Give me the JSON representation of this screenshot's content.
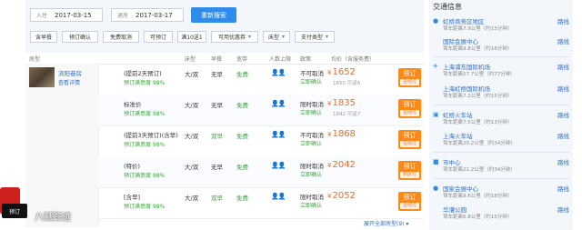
{
  "search": {
    "checkin_label": "入住",
    "checkin_value": "2017-03-15",
    "checkout_label": "退房",
    "checkout_value": "2017-03-17",
    "button": "重新搜索"
  },
  "filters": [
    {
      "label": "含早餐",
      "dropdown": false
    },
    {
      "label": "预订确认",
      "dropdown": false
    },
    {
      "label": "免费取消",
      "dropdown": false
    },
    {
      "label": "可预订",
      "dropdown": false
    },
    {
      "label": "满10送1",
      "dropdown": false
    },
    {
      "label": "可用优惠券",
      "dropdown": true
    },
    {
      "label": "床型",
      "dropdown": true
    },
    {
      "label": "支付类型",
      "dropdown": true
    }
  ],
  "table_headers": {
    "room_type": "房型",
    "bed": "床型",
    "breakfast": "早餐",
    "broadband": "宽带",
    "people": "人数上限",
    "policy": "政策",
    "price": "均价（含服务费）"
  },
  "room": {
    "name": "浏阳巷房",
    "detail": "查看详情"
  },
  "rates": [
    {
      "name": "(提前2天预订)",
      "satisfaction": "预订满意度 98%",
      "bed": "大/双",
      "breakfast": "无早",
      "breakfast_green": false,
      "wifi": "免费",
      "people": "👤👤",
      "policy": "不可取消",
      "policy2": "立即确认",
      "price": "1652",
      "price_sub": "1650 可返6",
      "book": "预订",
      "pay": "在线付"
    },
    {
      "name": "标准价",
      "satisfaction": "预订满意度 98%",
      "bed": "大/双",
      "breakfast": "无早",
      "breakfast_green": false,
      "wifi": "免费",
      "people": "👤👤",
      "policy": "限时取消",
      "policy2": "立即确认",
      "price": "1835",
      "price_sub": "1842 可返7",
      "book": "预订",
      "pay": "在线付"
    },
    {
      "name": "(提前3天预订)(含早)",
      "satisfaction": "预订满意度 98%",
      "bed": "大/双",
      "breakfast": "双早",
      "breakfast_green": true,
      "wifi": "免费",
      "people": "👤👤",
      "policy": "不可取消",
      "policy2": "立即确认",
      "price": "1868",
      "price_sub": "",
      "book": "预订",
      "pay": "在线付"
    },
    {
      "name": "(特价)",
      "satisfaction": "预订满意度 98%",
      "bed": "大/双",
      "breakfast": "无早",
      "breakfast_green": false,
      "wifi": "免费",
      "people": "👤👤",
      "policy": "限时取消",
      "policy2": "立即确认",
      "price": "2042",
      "price_sub": "",
      "book": "预订",
      "pay": "到店付"
    },
    {
      "name": "[含早]",
      "satisfaction": "预订满意度 98%",
      "bed": "大/双",
      "breakfast": "双早",
      "breakfast_green": true,
      "wifi": "免费",
      "people": "👤👤",
      "policy": "限时取消",
      "policy2": "立即确认",
      "price": "2052",
      "price_sub": "",
      "book": "预订",
      "pay": "在线付"
    }
  ],
  "more_link": "展开全部房型(9) ▾",
  "transport": {
    "title": "交通信息",
    "items": [
      {
        "icon": "location-pin-icon",
        "glyph": "●",
        "name": "虹桥商务区地区",
        "dist": "驾车距离7.9公里（约15分钟）",
        "link": "路线"
      },
      {
        "icon": "location-pin-icon",
        "glyph": "●",
        "name": "国际会展中心",
        "dist": "驾车距离9.8公里（约18分钟）",
        "link": "路线"
      },
      {
        "icon": "plane-icon",
        "glyph": "✈",
        "name": "上海浦东国际机场",
        "dist": "驾车距离57.7公里（约77分钟）",
        "link": "路线"
      },
      {
        "icon": "plane-icon",
        "glyph": "✈",
        "name": "上海虹桥国际机场",
        "dist": "驾车距离7.2公里（约15分钟）",
        "link": "路线"
      },
      {
        "icon": "train-icon",
        "glyph": "▣",
        "name": "虹桥火车站",
        "dist": "驾车距离7.5公里（约13分钟）",
        "link": "路线"
      },
      {
        "icon": "train-icon",
        "glyph": "▣",
        "name": "上海火车站",
        "dist": "驾车距离20.2公里（约34分钟）",
        "link": "路线"
      },
      {
        "icon": "city-icon",
        "glyph": "■",
        "name": "市中心",
        "dist": "驾车距离21.2公里（约34分钟）",
        "link": "路线"
      },
      {
        "icon": "landmark-icon",
        "glyph": "●",
        "name": "国家会展中心",
        "dist": "驾车距离9.6公里（约18分钟）",
        "link": "路线"
      },
      {
        "icon": "landmark-icon",
        "glyph": "",
        "name": "华漕公园",
        "dist": "驾车距离6.8公里（约15分钟）",
        "link": "路线"
      }
    ]
  },
  "watermark": {
    "badge": "预订",
    "text": "八赋踪迹"
  }
}
